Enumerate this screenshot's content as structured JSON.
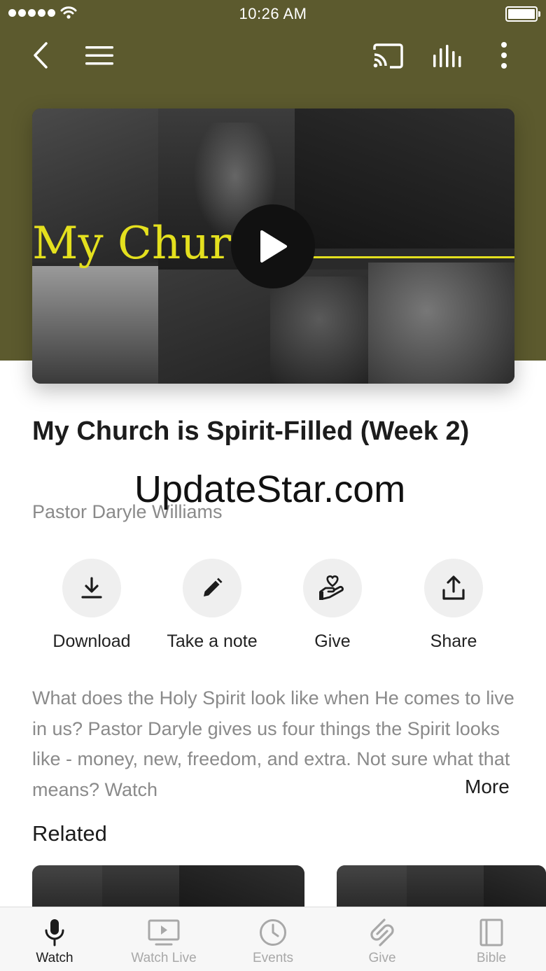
{
  "status_bar": {
    "time": "10:26 AM"
  },
  "toolbar": {
    "icons": [
      "back-icon",
      "menu-icon",
      "cast-icon",
      "audio-bars-icon",
      "more-vertical-icon"
    ]
  },
  "video": {
    "art_title": "My Church",
    "play_icon": "play-icon"
  },
  "sermon": {
    "title": "My Church is Spirit-Filled (Week 2)",
    "speaker": "Pastor Daryle Williams",
    "description": "What does the Holy Spirit look like when He comes to live in us? Pastor Daryle gives us four things the Spirit looks like - money, new, freedom, and extra. Not sure what that means? Watch",
    "more_label": "More"
  },
  "watermark": "UpdateStar.com",
  "actions": [
    {
      "label": "Download",
      "icon": "download-icon"
    },
    {
      "label": "Take a note",
      "icon": "pencil-icon"
    },
    {
      "label": "Give",
      "icon": "give-hand-heart-icon"
    },
    {
      "label": "Share",
      "icon": "share-icon"
    }
  ],
  "related": {
    "heading": "Related"
  },
  "tab_bar": {
    "tabs": [
      {
        "label": "Watch",
        "icon": "microphone-icon",
        "active": true
      },
      {
        "label": "Watch Live",
        "icon": "tv-play-icon",
        "active": false
      },
      {
        "label": "Events",
        "icon": "clock-icon",
        "active": false
      },
      {
        "label": "Give",
        "icon": "give-swirl-icon",
        "active": false
      },
      {
        "label": "Bible",
        "icon": "book-icon",
        "active": false
      }
    ]
  },
  "colors": {
    "header_background": "#5c5a2e",
    "art_yellow": "#e4e01e",
    "muted_text": "#8a8a8a",
    "action_circle": "#efefef"
  }
}
